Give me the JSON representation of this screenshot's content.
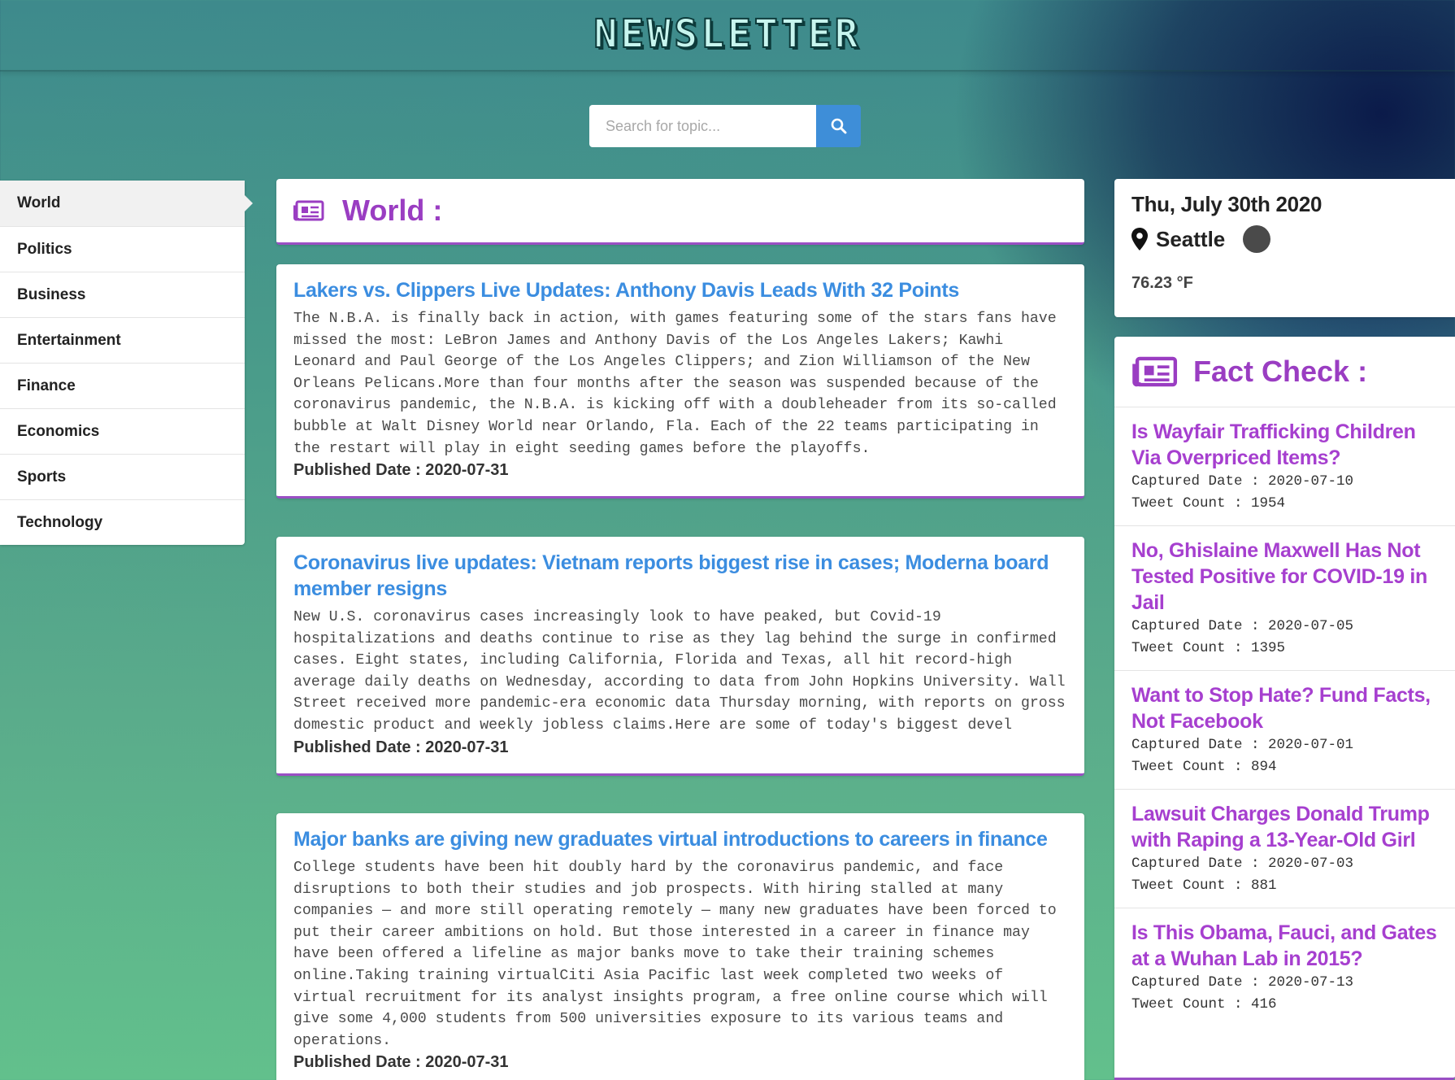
{
  "header": {
    "logo": "NEWSLETTER"
  },
  "search": {
    "placeholder": "Search for topic..."
  },
  "sidebar": {
    "items": [
      {
        "label": "World",
        "active": true
      },
      {
        "label": "Politics"
      },
      {
        "label": "Business"
      },
      {
        "label": "Entertainment"
      },
      {
        "label": "Finance"
      },
      {
        "label": "Economics"
      },
      {
        "label": "Sports"
      },
      {
        "label": "Technology"
      }
    ]
  },
  "main": {
    "section_title": "World :",
    "articles": [
      {
        "title": "Lakers vs. Clippers Live Updates: Anthony Davis Leads With 32 Points",
        "description": "The N.B.A. is finally back in action, with games featuring some of the stars fans have missed the most: LeBron James and Anthony Davis of the Los Angeles Lakers; Kawhi Leonard and Paul George of the Los Angeles Clippers; and Zion Williamson of the New Orleans Pelicans.More than four months after the season was suspended because of the coronavirus pandemic, the N.B.A. is kicking off with a doubleheader from its so-called bubble at Walt Disney World near Orlando, Fla. Each of the 22 teams participating in the restart will play in eight seeding games before the playoffs.",
        "published": "Published Date : 2020-07-31"
      },
      {
        "title": "Coronavirus live updates: Vietnam reports biggest rise in cases; Moderna board member resigns",
        "description": "New U.S. coronavirus cases increasingly look to have peaked, but Covid-19 hospitalizations and deaths continue to rise as they lag behind the surge in confirmed cases. Eight states, including California, Florida and Texas, all hit record-high average daily deaths on Wednesday, according to data from John Hopkins University. Wall Street received more pandemic-era economic data Thursday morning, with reports on gross domestic product and weekly jobless claims.Here are some of today's biggest devel",
        "published": "Published Date : 2020-07-31"
      },
      {
        "title": "Major banks are giving new graduates virtual introductions to careers in finance",
        "description": "College students have been hit doubly hard by the coronavirus pandemic, and face disruptions to both their studies and job prospects. With hiring stalled at many companies — and more still operating remotely — many new graduates have been forced to put their career ambitions on hold. But those interested in a career in finance may have been offered a lifeline as major banks move to take their training schemes online.Taking training virtualCiti Asia Pacific last week completed two weeks of virtual recruitment for its analyst insights program, a free online course which will give some 4,000 students from 500 universities exposure to its various teams and operations.",
        "published": "Published Date : 2020-07-31"
      }
    ]
  },
  "weather": {
    "date": "Thu, July 30th 2020",
    "city": "Seattle",
    "temperature": "76.23 °F"
  },
  "fact_check": {
    "title": "Fact Check :",
    "items": [
      {
        "title": "Is Wayfair Trafficking Children Via Overpriced Items?",
        "captured": "Captured Date : 2020-07-10",
        "tweets": "Tweet Count : 1954"
      },
      {
        "title": "No, Ghislaine Maxwell Has Not Tested Positive for COVID-19 in Jail",
        "captured": "Captured Date : 2020-07-05",
        "tweets": "Tweet Count : 1395"
      },
      {
        "title": "Want to Stop Hate? Fund Facts, Not Facebook",
        "captured": "Captured Date : 2020-07-01",
        "tweets": "Tweet Count : 894"
      },
      {
        "title": "Lawsuit Charges Donald Trump with Raping a 13-Year-Old Girl",
        "captured": "Captured Date : 2020-07-03",
        "tweets": "Tweet Count : 881"
      },
      {
        "title": "Is This Obama, Fauci, and Gates at a Wuhan Lab in 2015?",
        "captured": "Captured Date : 2020-07-13",
        "tweets": "Tweet Count : 416"
      }
    ]
  },
  "icons": {
    "search": "search-icon",
    "newspaper": "newspaper-icon",
    "location": "map-marker-icon",
    "weather": "weather-icon"
  },
  "colors": {
    "accent_purple": "#9a3dc2",
    "link_blue": "#3b8de0",
    "search_button": "#3e8ed8"
  }
}
